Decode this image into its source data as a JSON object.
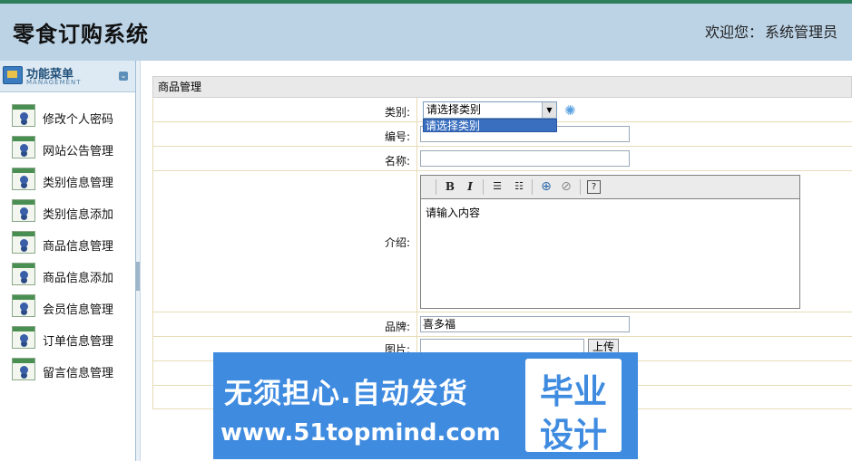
{
  "header": {
    "title": "零食订购系统",
    "welcome_prefix": "欢迎您：",
    "user": "系统管理员"
  },
  "sidebar": {
    "title": "功能菜单",
    "subtitle": "MANAGEMENT",
    "items": [
      {
        "label": "修改个人密码",
        "icon": "user-icon"
      },
      {
        "label": "网站公告管理",
        "icon": "user-icon"
      },
      {
        "label": "类别信息管理",
        "icon": "user-icon"
      },
      {
        "label": "类别信息添加",
        "icon": "user-icon"
      },
      {
        "label": "商品信息管理",
        "icon": "user-icon"
      },
      {
        "label": "商品信息添加",
        "icon": "user-icon"
      },
      {
        "label": "会员信息管理",
        "icon": "user-icon"
      },
      {
        "label": "订单信息管理",
        "icon": "user-icon"
      },
      {
        "label": "留言信息管理",
        "icon": "user-icon"
      }
    ]
  },
  "main": {
    "panel_title": "商品管理",
    "form": {
      "category_label": "类别:",
      "category_value": "请选择类别",
      "category_options": [
        "请选择类别"
      ],
      "number_label": "编号:",
      "number_value": "",
      "name_label": "名称:",
      "name_value": "",
      "description_label": "介绍:",
      "description_value": "请输入内容",
      "brand_label": "品牌:",
      "brand_value": "喜多福",
      "image_label": "图片:",
      "upload_label": "上传"
    }
  },
  "watermark": {
    "main": "无须担心.自动发货",
    "url": "www.51topmind.com",
    "badge_line1": "毕业",
    "badge_line2": "设计"
  }
}
